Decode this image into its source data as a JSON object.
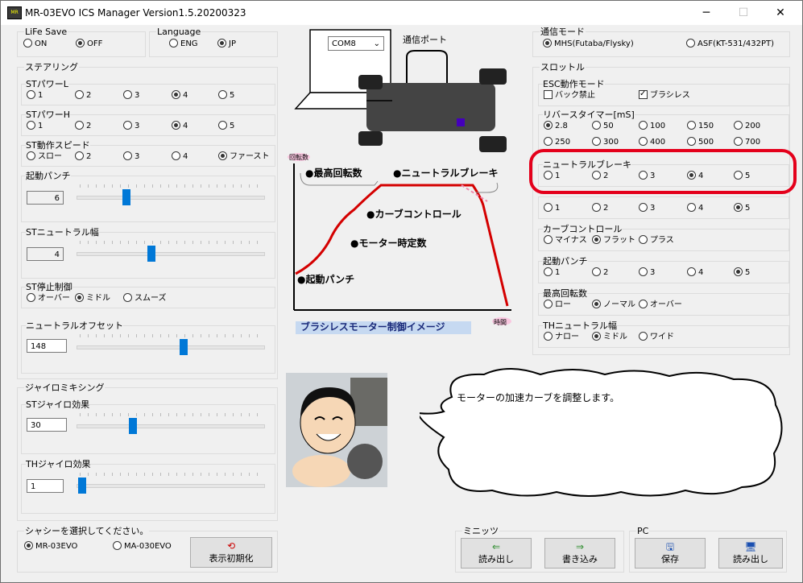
{
  "window": {
    "title": "MR-03EVO ICS Manager Version1.5.20200323",
    "minimize": "─",
    "maximize": "☐",
    "close": "✕"
  },
  "life_save": {
    "label": "LiFe Save",
    "options": [
      "ON",
      "OFF"
    ]
  },
  "language": {
    "label": "Language",
    "options": [
      "ENG",
      "JP"
    ]
  },
  "steering": {
    "label": "ステアリング",
    "st_power_l": {
      "label": "STパワーL",
      "options": [
        "1",
        "2",
        "3",
        "4",
        "5"
      ]
    },
    "st_power_h": {
      "label": "STパワーH",
      "options": [
        "1",
        "2",
        "3",
        "4",
        "5"
      ]
    },
    "st_speed": {
      "label": "ST動作スピード",
      "options": [
        "スロー",
        "2",
        "3",
        "4",
        "ファースト"
      ]
    },
    "kido_punch": {
      "label": "起動パンチ",
      "value": "6"
    },
    "st_neutral": {
      "label": "STニュートラル幅",
      "value": "4"
    },
    "st_stop": {
      "label": "ST停止制御",
      "options": [
        "オーバー",
        "ミドル",
        "スムーズ"
      ]
    },
    "neutral_offset": {
      "label": "ニュートラルオフセット",
      "value": "148"
    }
  },
  "gyro": {
    "label": "ジャイロミキシング",
    "st_gyro": {
      "label": "STジャイロ効果",
      "value": "30"
    },
    "th_gyro": {
      "label": "THジャイロ効果",
      "value": "1"
    }
  },
  "chassis": {
    "label": "シャシーを選択してください。",
    "options": [
      "MR-03EVO",
      "MA-030EVO"
    ],
    "reset_button": "表示初期化"
  },
  "center": {
    "com_port": "COM8",
    "com_label": "通信ポート",
    "graph_y": "回転数",
    "graph_x": "時間",
    "max_rpm": "●最高回転数",
    "neutral_brake": "●ニュートラルブレーキ",
    "curve": "●カーブコントロール",
    "motor_const": "●モーター時定数",
    "punch": "●起動パンチ",
    "caption": "ブラシレスモーター制御イメージ",
    "speech": "モーターの加速カーブを調整します。"
  },
  "comm_mode": {
    "label": "通信モード",
    "options": [
      "MHS(Futaba/Flysky)",
      "ASF(KT-531/432PT)"
    ]
  },
  "throttle": {
    "label": "スロットル",
    "esc_mode": {
      "label": "ESC動作モード",
      "options": [
        "バック禁止",
        "ブラシレス"
      ]
    },
    "reverse_timer": {
      "label": "リバースタイマー[mS]",
      "row1": [
        "2.8",
        "50",
        "100",
        "150",
        "200"
      ],
      "row2": [
        "250",
        "300",
        "400",
        "500",
        "700"
      ]
    },
    "neutral_brake": {
      "label": "ニュートラルブレーキ",
      "options": [
        "1",
        "2",
        "3",
        "4",
        "5"
      ]
    },
    "hidden_row": {
      "options": [
        "1",
        "2",
        "3",
        "4",
        "5"
      ]
    },
    "curve_control": {
      "label": "カーブコントロール",
      "options": [
        "マイナス",
        "フラット",
        "プラス"
      ]
    },
    "kido_punch": {
      "label": "起動パンチ",
      "options": [
        "1",
        "2",
        "3",
        "4",
        "5"
      ]
    },
    "max_rpm": {
      "label": "最高回転数",
      "options": [
        "ロー",
        "ノーマル",
        "オーバー"
      ]
    },
    "th_neutral": {
      "label": "THニュートラル幅",
      "options": [
        "ナロー",
        "ミドル",
        "ワイド"
      ]
    }
  },
  "minits": {
    "label": "ミニッツ",
    "read": "読み出し",
    "write": "書き込み"
  },
  "pc": {
    "label": "PC",
    "save": "保存",
    "read": "読み出し"
  },
  "colors": {
    "accent": "#0078d7",
    "highlight": "#e4001b",
    "curve": "#d40000"
  }
}
